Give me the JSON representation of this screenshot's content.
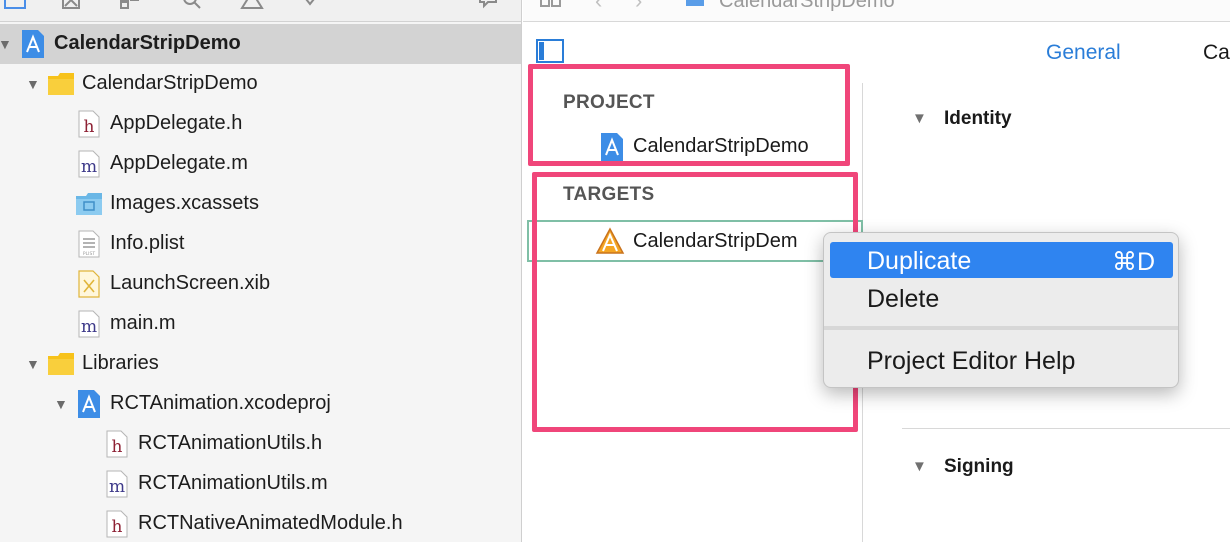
{
  "navigator": {
    "items": [
      {
        "label": "CalendarStripDemo",
        "kind": "project",
        "disclosure": "▼",
        "selected": true
      },
      {
        "label": "CalendarStripDemo",
        "kind": "folder",
        "disclosure": "▼"
      },
      {
        "label": "AppDelegate.h",
        "kind": "h",
        "glyph": "h"
      },
      {
        "label": "AppDelegate.m",
        "kind": "m",
        "glyph": "m"
      },
      {
        "label": "Images.xcassets",
        "kind": "xcassets"
      },
      {
        "label": "Info.plist",
        "kind": "plist",
        "glyph": "PLIST"
      },
      {
        "label": "LaunchScreen.xib",
        "kind": "xib"
      },
      {
        "label": "main.m",
        "kind": "m",
        "glyph": "m"
      },
      {
        "label": "Libraries",
        "kind": "folder",
        "disclosure": "▼"
      },
      {
        "label": "RCTAnimation.xcodeproj",
        "kind": "project",
        "disclosure": "▼"
      },
      {
        "label": "RCTAnimationUtils.h",
        "kind": "h",
        "glyph": "h"
      },
      {
        "label": "RCTAnimationUtils.m",
        "kind": "m",
        "glyph": "m"
      },
      {
        "label": "RCTNativeAnimatedModule.h",
        "kind": "h",
        "glyph": "h"
      }
    ]
  },
  "jumpbar": {
    "path": "CalendarStripDemo"
  },
  "tabs": {
    "general": "General",
    "next_partial": "Ca"
  },
  "targets_panel": {
    "project_header": "PROJECT",
    "project_item": "CalendarStripDemo",
    "targets_header": "TARGETS",
    "target_item": "CalendarStripDem"
  },
  "settings": {
    "identity": "Identity",
    "signing": "Signing"
  },
  "context_menu": {
    "duplicate": "Duplicate",
    "duplicate_shortcut": "⌘D",
    "delete": "Delete",
    "help": "Project Editor Help"
  },
  "colors": {
    "highlight": "#f0467a",
    "accent": "#2a7dd8",
    "menu_hover": "#2f84f0",
    "selection": "#d3d3d3"
  }
}
